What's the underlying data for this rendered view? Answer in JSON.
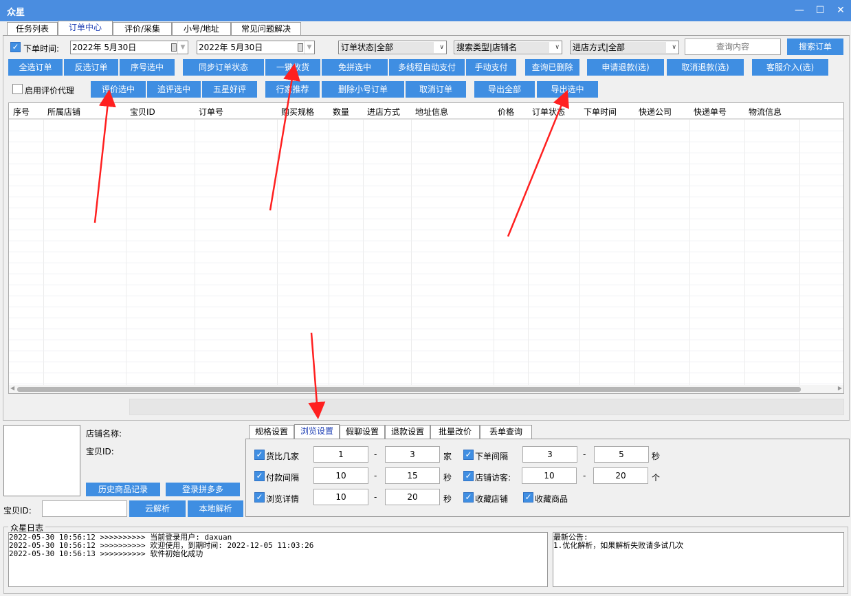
{
  "window": {
    "title": "众星",
    "minimize_icon": "—",
    "maximize_icon": "☐",
    "close_icon": "✕"
  },
  "tabs": [
    {
      "label": "任务列表"
    },
    {
      "label": "订单中心",
      "active": true
    },
    {
      "label": "评价/采集"
    },
    {
      "label": "小号/地址"
    },
    {
      "label": "常见问题解决"
    }
  ],
  "filters": {
    "order_time_label": "下单时间:",
    "order_time_checked": true,
    "date_start": "2022年  5月30日",
    "date_end": "2022年  5月30日",
    "order_status": "订单状态|全部",
    "search_type": "搜索类型|店铺名",
    "entry_method": "进店方式|全部",
    "query_placeholder": "查询内容",
    "search_button": "搜索订单"
  },
  "toolbar_row1": [
    "全选订单",
    "反选订单",
    "序号选中",
    "同步订单状态",
    "一键收货",
    "免拼选中",
    "多线程自动支付",
    "手动支付",
    "查询已删除",
    "申请退款(选)",
    "取消退款(选)",
    "客服介入(选)"
  ],
  "toolbar_row2": {
    "proxy_label": "启用评价代理",
    "proxy_checked": false,
    "buttons": [
      "评价选中",
      "追评选中",
      "五星好评",
      "行家推荐",
      "删除小号订单",
      "取消订单",
      "导出全部",
      "导出选中"
    ]
  },
  "table": {
    "columns": [
      "序号",
      "所属店铺",
      "宝贝ID",
      "订单号",
      "购买规格",
      "数量",
      "进店方式",
      "地址信息",
      "价格",
      "订单状态",
      "下单时间",
      "快递公司",
      "快递单号",
      "物流信息"
    ]
  },
  "product": {
    "shop_name_label": "店铺名称:",
    "item_id_label": "宝贝ID:",
    "history_button": "历史商品记录",
    "login_button": "登录拼多多",
    "item_id_input_label": "宝贝ID:",
    "cloud_parse_button": "云解析",
    "local_parse_button": "本地解析"
  },
  "subtabs": [
    {
      "label": "规格设置"
    },
    {
      "label": "浏览设置",
      "active": true
    },
    {
      "label": "假聊设置"
    },
    {
      "label": "退款设置"
    },
    {
      "label": "批量改价"
    },
    {
      "label": "丢单查询"
    }
  ],
  "browse_settings": {
    "rows": [
      {
        "left_label": "货比几家",
        "left_min": "1",
        "left_max": "3",
        "left_unit": "家",
        "right_label": "下单间隔",
        "right_min": "3",
        "right_max": "5",
        "right_unit": "秒"
      },
      {
        "left_label": "付款间隔",
        "left_min": "10",
        "left_max": "15",
        "left_unit": "秒",
        "right_label": "店铺访客:",
        "right_min": "10",
        "right_max": "20",
        "right_unit": "个"
      },
      {
        "left_label": "浏览详情",
        "left_min": "10",
        "left_max": "20",
        "left_unit": "秒",
        "right_label": "收藏店铺",
        "extra_label": "收藏商品"
      }
    ],
    "dash": "-"
  },
  "log": {
    "title": "众星日志",
    "lines": [
      "2022-05-30 10:56:12 >>>>>>>>>> 当前登录用户: daxuan",
      "2022-05-30 10:56:12 >>>>>>>>>> 欢迎使用，到期时间: 2022-12-05 11:03:26",
      "2022-05-30 10:56:13 >>>>>>>>>> 软件初始化成功"
    ],
    "notice_title": "最新公告:",
    "notice_text": "1.优化解析，如果解析失败请多试几次"
  },
  "colors": {
    "accent": "#3f8ee2",
    "titlebar": "#4a8de0",
    "arrow": "#ff2020"
  }
}
